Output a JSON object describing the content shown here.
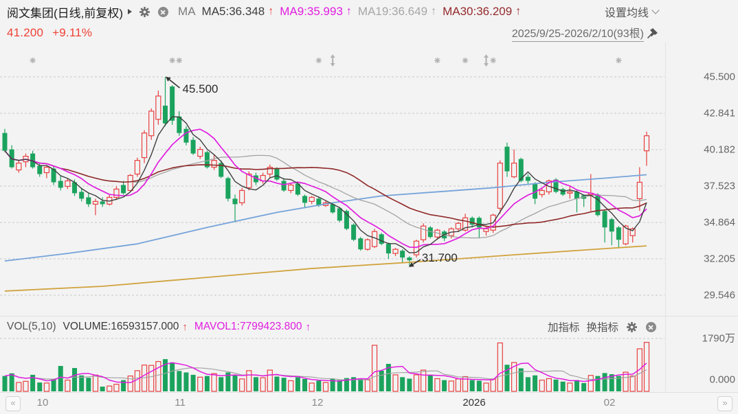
{
  "header": {
    "title": "阅文集团(日线,前复权)",
    "ma_overlay_label": "MA",
    "ma_values": [
      {
        "name": "MA5",
        "label": "MA5:36.348",
        "arrow": "↑"
      },
      {
        "name": "MA9",
        "label": "MA9:35.993",
        "arrow": "↑"
      },
      {
        "name": "MA19",
        "label": "MA19:36.649",
        "arrow": "↑"
      },
      {
        "name": "MA30",
        "label": "MA30:36.209",
        "arrow": "↑"
      }
    ],
    "settings_ma_label": "设置均线",
    "price": "41.200",
    "change_percent": "+9.11%",
    "visible_range": "2025/9/25-2026/2/10(93根)"
  },
  "volume_header": {
    "indicator": "VOL(5,10)",
    "volume": "VOLUME:16593157.000",
    "volume_arrow": "↑",
    "mavol": "MAVOL1:7799423.800",
    "mavol_arrow": "↑",
    "add_indicator": "加指标",
    "switch_indicator": "换指标"
  },
  "y_axis": {
    "price_labels": [
      "45.500",
      "42.841",
      "40.182",
      "37.523",
      "34.864",
      "32.205",
      "29.546"
    ],
    "volume_max": "1790万",
    "volume_min": "0.000"
  },
  "x_axis": {
    "labels": [
      "10",
      "11",
      "12",
      "2026",
      "02"
    ],
    "prev_button": "«",
    "next_button": "»"
  },
  "annotations": {
    "high_label": "45.500",
    "low_label": "31.700"
  },
  "colors": {
    "up": "#e83f3f",
    "down": "#1ba35d",
    "ma5": "#3e3e3e",
    "ma9": "#e01de0",
    "ma19": "#a3a3a3",
    "ma30": "#8f2727",
    "blue_line": "#75a3da",
    "gold_line": "#d0a23c",
    "grid": "#c7c7c7",
    "bg": "#f3f3f3",
    "price_text": "#f04134",
    "marker": "#b3b3b3",
    "annotation_text": "#2b2b2b"
  },
  "chart_data": {
    "type": "candlestick+volume",
    "title": "阅文集团 日线 前复权",
    "date_range": "2025/9/25-2026/2/10",
    "bars": 93,
    "price_axis": {
      "min": 29.546,
      "max": 45.5,
      "ticks": [
        45.5,
        42.841,
        40.182,
        37.523,
        34.864,
        32.205,
        29.546
      ]
    },
    "volume_axis_wan": {
      "min": 0,
      "max": 1790
    },
    "high_point": {
      "bar": 23,
      "price": 45.5
    },
    "low_point": {
      "bar": 58,
      "price": 31.7
    },
    "candles": [
      [
        41.4,
        41.7,
        40.0,
        40.1
      ],
      [
        40.2,
        40.5,
        38.8,
        38.9
      ],
      [
        38.7,
        39.4,
        38.5,
        39.2
      ],
      [
        39.3,
        39.9,
        38.9,
        39.7
      ],
      [
        39.9,
        40.1,
        38.8,
        38.9
      ],
      [
        39.0,
        39.2,
        38.2,
        38.4
      ],
      [
        38.5,
        39.0,
        38.1,
        38.9
      ],
      [
        38.8,
        39.0,
        37.6,
        37.8
      ],
      [
        37.9,
        38.3,
        37.2,
        37.4
      ],
      [
        37.5,
        38.1,
        37.3,
        37.9
      ],
      [
        37.8,
        38.0,
        36.8,
        37.0
      ],
      [
        37.1,
        37.4,
        36.4,
        36.6
      ],
      [
        36.7,
        37.0,
        36.0,
        36.2
      ],
      [
        36.2,
        36.6,
        35.4,
        36.4
      ],
      [
        36.4,
        36.7,
        36.0,
        36.2
      ],
      [
        36.2,
        36.9,
        36.1,
        36.7
      ],
      [
        36.7,
        37.5,
        36.5,
        37.3
      ],
      [
        37.6,
        37.9,
        36.9,
        37.0
      ],
      [
        37.2,
        38.4,
        37.1,
        38.3
      ],
      [
        38.4,
        39.6,
        38.2,
        39.4
      ],
      [
        39.6,
        41.6,
        39.2,
        41.4
      ],
      [
        41.2,
        43.2,
        40.9,
        43.0
      ],
      [
        42.4,
        44.5,
        42.0,
        44.1
      ],
      [
        43.4,
        45.5,
        41.9,
        42.1
      ],
      [
        44.8,
        44.9,
        42.0,
        42.3
      ],
      [
        42.6,
        43.0,
        41.2,
        41.4
      ],
      [
        41.7,
        41.9,
        40.5,
        40.7
      ],
      [
        40.9,
        41.1,
        39.8,
        39.9
      ],
      [
        39.7,
        40.4,
        39.5,
        40.2
      ],
      [
        40.0,
        40.1,
        38.8,
        38.9
      ],
      [
        38.9,
        39.8,
        38.7,
        39.4
      ],
      [
        39.2,
        39.4,
        38.1,
        38.2
      ],
      [
        38.1,
        38.2,
        36.4,
        36.6
      ],
      [
        36.6,
        36.9,
        34.9,
        36.2
      ],
      [
        36.3,
        37.4,
        36.1,
        37.2
      ],
      [
        37.4,
        38.6,
        37.2,
        38.4
      ],
      [
        38.3,
        38.5,
        37.6,
        37.8
      ],
      [
        37.9,
        38.5,
        37.7,
        38.3
      ],
      [
        38.4,
        39.1,
        38.1,
        38.9
      ],
      [
        38.8,
        38.9,
        37.9,
        38.0
      ],
      [
        37.9,
        38.1,
        37.1,
        37.2
      ],
      [
        37.2,
        37.7,
        37.0,
        37.6
      ],
      [
        37.7,
        37.8,
        36.8,
        36.9
      ],
      [
        36.8,
        36.9,
        35.9,
        36.3
      ],
      [
        36.4,
        36.8,
        36.2,
        36.7
      ],
      [
        36.6,
        36.7,
        36.0,
        36.1
      ],
      [
        36.1,
        36.5,
        36.0,
        36.3
      ],
      [
        36.2,
        36.3,
        35.5,
        35.6
      ],
      [
        35.9,
        36.0,
        34.9,
        35.0
      ],
      [
        35.7,
        35.8,
        34.3,
        34.4
      ],
      [
        34.7,
        34.8,
        33.5,
        33.6
      ],
      [
        33.7,
        33.8,
        32.8,
        32.9
      ],
      [
        32.9,
        33.7,
        32.8,
        33.6
      ],
      [
        33.1,
        34.4,
        33.0,
        34.2
      ],
      [
        34.0,
        34.1,
        33.2,
        33.3
      ],
      [
        33.3,
        33.4,
        32.2,
        32.6
      ],
      [
        32.6,
        33.0,
        32.4,
        32.9
      ],
      [
        32.8,
        32.9,
        31.9,
        32.3
      ],
      [
        32.3,
        32.4,
        31.7,
        32.1
      ],
      [
        32.5,
        33.6,
        32.3,
        33.5
      ],
      [
        33.6,
        34.8,
        33.4,
        34.6
      ],
      [
        34.5,
        34.6,
        33.7,
        33.8
      ],
      [
        33.8,
        34.4,
        33.6,
        34.3
      ],
      [
        34.2,
        34.3,
        33.5,
        33.7
      ],
      [
        33.9,
        34.5,
        33.7,
        34.4
      ],
      [
        34.4,
        34.9,
        34.2,
        34.8
      ],
      [
        34.3,
        35.5,
        34.2,
        35.2
      ],
      [
        35.2,
        35.3,
        34.5,
        34.7
      ],
      [
        35.2,
        35.3,
        33.7,
        34.5
      ],
      [
        34.2,
        34.6,
        33.9,
        34.4
      ],
      [
        34.3,
        35.5,
        34.1,
        35.4
      ],
      [
        35.9,
        39.4,
        35.5,
        39.2
      ],
      [
        40.4,
        40.7,
        38.2,
        38.6
      ],
      [
        38.2,
        40.2,
        38.1,
        39.2
      ],
      [
        39.5,
        39.6,
        37.8,
        37.9
      ],
      [
        38.2,
        38.4,
        37.7,
        37.9
      ],
      [
        37.7,
        37.8,
        36.2,
        36.6
      ],
      [
        36.9,
        37.4,
        36.7,
        37.2
      ],
      [
        37.1,
        38.0,
        36.9,
        37.9
      ],
      [
        38.0,
        38.1,
        37.0,
        37.1
      ],
      [
        37.3,
        37.4,
        36.8,
        36.9
      ],
      [
        37.0,
        37.5,
        36.6,
        37.1
      ],
      [
        37.1,
        37.2,
        35.6,
        36.6
      ],
      [
        36.85,
        36.9,
        36.0,
        36.6
      ],
      [
        36.9,
        38.4,
        35.7,
        37.0
      ],
      [
        36.9,
        37.0,
        35.3,
        35.4
      ],
      [
        35.7,
        35.8,
        33.4,
        34.5
      ],
      [
        35.1,
        35.2,
        33.2,
        34.2
      ],
      [
        34.5,
        34.6,
        33.0,
        33.6
      ],
      [
        33.3,
        34.7,
        33.2,
        34.6
      ],
      [
        33.9,
        34.5,
        33.4,
        34.4
      ],
      [
        36.6,
        38.9,
        35.7,
        37.8
      ],
      [
        40.1,
        41.5,
        39.0,
        41.2
      ]
    ],
    "volumes_wan": [
      520,
      610,
      300,
      340,
      560,
      300,
      280,
      420,
      860,
      380,
      790,
      540,
      460,
      550,
      160,
      180,
      240,
      380,
      520,
      700,
      890,
      880,
      1010,
      1090,
      980,
      690,
      640,
      560,
      480,
      520,
      600,
      480,
      640,
      540,
      420,
      700,
      480,
      460,
      720,
      500,
      460,
      360,
      480,
      420,
      280,
      360,
      300,
      420,
      380,
      450,
      480,
      420,
      390,
      1560,
      700,
      930,
      560,
      480,
      430,
      560,
      720,
      560,
      430,
      380,
      350,
      420,
      500,
      380,
      360,
      280,
      420,
      1640,
      900,
      975,
      780,
      480,
      540,
      380,
      430,
      400,
      330,
      280,
      380,
      280,
      540,
      520,
      620,
      580,
      520,
      650,
      520,
      1440,
      1659.3157
    ],
    "overlay_lines": {
      "blue": [
        [
          0,
          32.05
        ],
        [
          9,
          32.6
        ],
        [
          19,
          33.3
        ],
        [
          29,
          34.5
        ],
        [
          39,
          35.6
        ],
        [
          47,
          36.3
        ],
        [
          54,
          36.8
        ],
        [
          62,
          37.1
        ],
        [
          70,
          37.4
        ],
        [
          78,
          37.8
        ],
        [
          86,
          38.1
        ],
        [
          92,
          38.35
        ]
      ],
      "gold": [
        [
          0,
          29.85
        ],
        [
          14,
          30.2
        ],
        [
          29,
          30.85
        ],
        [
          44,
          31.5
        ],
        [
          58,
          31.95
        ],
        [
          73,
          32.5
        ],
        [
          86,
          32.95
        ],
        [
          92,
          33.15
        ]
      ]
    },
    "event_markers": [
      {
        "bar": 4,
        "kind": "star"
      },
      {
        "bar": 24,
        "kind": "star"
      },
      {
        "bar": 25,
        "kind": "star"
      },
      {
        "bar": 45,
        "kind": "star"
      },
      {
        "bar": 47,
        "kind": "updown"
      },
      {
        "bar": 62,
        "kind": "star"
      },
      {
        "bar": 66,
        "kind": "star"
      },
      {
        "bar": 69,
        "kind": "updown"
      },
      {
        "bar": 70,
        "kind": "star"
      },
      {
        "bar": 88,
        "kind": "star"
      }
    ]
  }
}
